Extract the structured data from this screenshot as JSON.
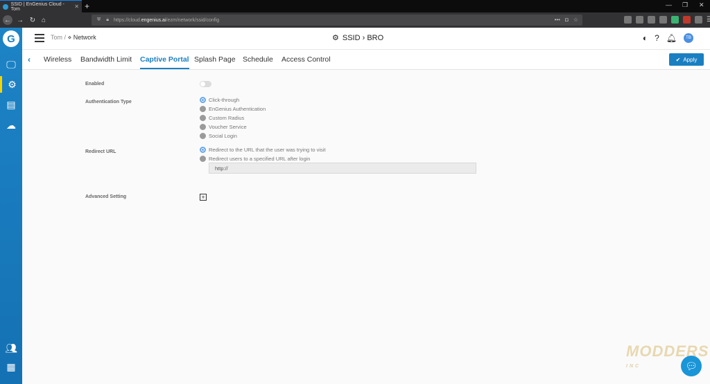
{
  "browser": {
    "tab_title": "SSID | EnGenius Cloud - Tom",
    "url_prefix": "https://cloud.",
    "url_host": "engenius.ai",
    "url_path": "/ezm/network/ssid/config"
  },
  "header": {
    "breadcrumb_root": "Tom",
    "breadcrumb_sep": "/",
    "breadcrumb_current": "Network",
    "page_title": "SSID › BRO",
    "avatar": "TB"
  },
  "tabs": {
    "items": [
      "Wireless",
      "Bandwidth Limit",
      "Captive Portal",
      "Splash Page",
      "Schedule",
      "Access Control"
    ],
    "active": "Captive Portal",
    "apply_label": "Apply"
  },
  "form": {
    "enabled_label": "Enabled",
    "enabled": false,
    "auth_label": "Authentication Type",
    "auth_options": [
      "Click-through",
      "EnGenius Authentication",
      "Custom Radius",
      "Voucher Service",
      "Social Login"
    ],
    "auth_selected": "Click-through",
    "redirect_label": "Redirect URL",
    "redirect_options": [
      "Redirect to the URL that the user was trying to visit",
      "Redirect users to a specified URL after login"
    ],
    "redirect_selected": "Redirect to the URL that the user was trying to visit",
    "redirect_url_value": "http://",
    "advanced_label": "Advanced Setting"
  },
  "watermark": {
    "line1": "MODDERS",
    "line2": "INC"
  },
  "colors": {
    "accent": "#1a7fc1",
    "rail": "#1d84c6",
    "rail_active_marker": "#f5d400"
  }
}
